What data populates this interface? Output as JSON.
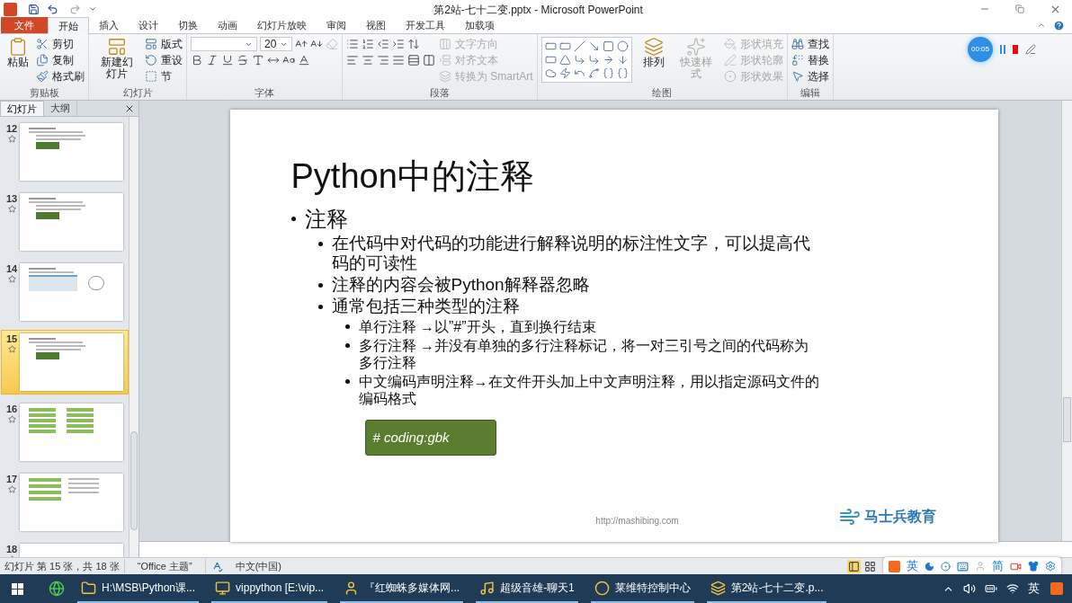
{
  "window": {
    "title": "第2站-七十二变.pptx - Microsoft PowerPoint"
  },
  "ribbon_tabs": [
    {
      "label": "文件",
      "kind": "file",
      "selected": false
    },
    {
      "label": "开始",
      "kind": "tab",
      "selected": true
    },
    {
      "label": "插入",
      "kind": "tab",
      "selected": false
    },
    {
      "label": "设计",
      "kind": "tab",
      "selected": false
    },
    {
      "label": "切换",
      "kind": "tab",
      "selected": false
    },
    {
      "label": "动画",
      "kind": "tab",
      "selected": false
    },
    {
      "label": "幻灯片放映",
      "kind": "tab",
      "selected": false
    },
    {
      "label": "审阅",
      "kind": "tab",
      "selected": false
    },
    {
      "label": "视图",
      "kind": "tab",
      "selected": false
    },
    {
      "label": "开发工具",
      "kind": "tab",
      "selected": false
    },
    {
      "label": "加载项",
      "kind": "tab",
      "selected": false
    }
  ],
  "ribbon_groups": [
    {
      "title": "剪贴板",
      "parts": [
        {
          "kind": "large",
          "label": "粘贴",
          "disabled": false
        },
        {
          "kind": "stack",
          "rows": [
            [
              {
                "kind": "small",
                "label": "剪切",
                "disabled": false
              }
            ],
            [
              {
                "kind": "small",
                "label": "复制",
                "disabled": false
              }
            ],
            [
              {
                "kind": "small",
                "label": "格式刷",
                "disabled": false
              }
            ]
          ]
        }
      ]
    },
    {
      "title": "幻灯片",
      "parts": [
        {
          "kind": "large",
          "label": "新建幻灯片",
          "disabled": false
        },
        {
          "kind": "stack",
          "rows": [
            [
              {
                "kind": "small",
                "label": "版式",
                "disabled": false
              }
            ],
            [
              {
                "kind": "small",
                "label": "重设",
                "disabled": false
              }
            ],
            [
              {
                "kind": "small",
                "label": "节",
                "disabled": false
              }
            ]
          ]
        }
      ]
    },
    {
      "title": "字体",
      "parts": [
        {
          "kind": "stack",
          "rows": [
            [
              {
                "kind": "select",
                "disabled": false,
                "wide": true
              },
              {
                "kind": "select",
                "value": "20",
                "disabled": false,
                "wide": false
              },
              {
                "kind": "icon",
                "disabled": false
              },
              {
                "kind": "icon",
                "disabled": false
              },
              {
                "kind": "icon",
                "disabled": true
              }
            ],
            [
              {
                "kind": "icon",
                "disabled": false
              },
              {
                "kind": "icon",
                "disabled": false
              },
              {
                "kind": "icon",
                "disabled": false
              },
              {
                "kind": "icon",
                "disabled": false
              },
              {
                "kind": "icon",
                "disabled": false
              },
              {
                "kind": "icon",
                "disabled": false
              },
              {
                "kind": "icon",
                "disabled": false
              },
              {
                "kind": "icon",
                "disabled": false
              }
            ]
          ]
        }
      ]
    },
    {
      "title": "段落",
      "parts": [
        {
          "kind": "stack",
          "rows": [
            [
              {
                "kind": "icon",
                "disabled": false
              },
              {
                "kind": "icon",
                "disabled": false
              },
              {
                "kind": "icon",
                "disabled": false
              },
              {
                "kind": "icon",
                "disabled": false
              },
              {
                "kind": "icon",
                "disabled": false
              }
            ],
            [
              {
                "kind": "icon",
                "disabled": false
              },
              {
                "kind": "icon",
                "disabled": false
              },
              {
                "kind": "icon",
                "disabled": false
              },
              {
                "kind": "icon",
                "disabled": false
              },
              {
                "kind": "icon",
                "disabled": false
              },
              {
                "kind": "icon",
                "disabled": false
              }
            ]
          ]
        },
        {
          "kind": "stack",
          "rows": [
            [
              {
                "kind": "small",
                "label": "文字方向",
                "disabled": true
              }
            ],
            [
              {
                "kind": "small",
                "label": "对齐文本",
                "disabled": true
              }
            ],
            [
              {
                "kind": "small",
                "label": "转换为 SmartArt",
                "disabled": true
              }
            ]
          ]
        }
      ]
    },
    {
      "title": "绘图",
      "parts": [
        {
          "kind": "gallery"
        },
        {
          "kind": "large",
          "label": "排列",
          "disabled": false
        },
        {
          "kind": "large",
          "label": "快速样式",
          "disabled": true
        },
        {
          "kind": "stack",
          "rows": [
            [
              {
                "kind": "small",
                "label": "形状填充",
                "disabled": true
              }
            ],
            [
              {
                "kind": "small",
                "label": "形状轮廓",
                "disabled": true
              }
            ],
            [
              {
                "kind": "small",
                "label": "形状效果",
                "disabled": true
              }
            ]
          ]
        }
      ]
    },
    {
      "title": "编辑",
      "parts": [
        {
          "kind": "stack",
          "rows": [
            [
              {
                "kind": "small",
                "label": "查找",
                "disabled": false
              }
            ],
            [
              {
                "kind": "small",
                "label": "替换",
                "disabled": false
              }
            ],
            [
              {
                "kind": "small",
                "label": "选择",
                "disabled": false
              }
            ]
          ]
        }
      ]
    }
  ],
  "recorder": {
    "time": "00:05"
  },
  "slides_panel": {
    "tabs": [
      {
        "label": "幻灯片",
        "selected": true
      },
      {
        "label": "大纲",
        "selected": false
      }
    ],
    "thumbnails": [
      {
        "number": "12",
        "selected": false,
        "kind": "list"
      },
      {
        "number": "13",
        "selected": false,
        "kind": "list"
      },
      {
        "number": "14",
        "selected": false,
        "kind": "table"
      },
      {
        "number": "15",
        "selected": true,
        "kind": "list"
      },
      {
        "number": "16",
        "selected": false,
        "kind": "map"
      },
      {
        "number": "17",
        "selected": false,
        "kind": "summary"
      },
      {
        "number": "18",
        "selected": false,
        "kind": "text"
      }
    ]
  },
  "slide": {
    "title": "Python中的注释",
    "bullets": [
      {
        "text": "注释",
        "children": [
          {
            "text": "在代码中对代码的功能进行解释说明的标注性文字，可以提高代码的可读性"
          },
          {
            "text": "注释的内容会被Python解释器忽略"
          },
          {
            "text": "通常包括三种类型的注释",
            "children": [
              {
                "text": "单行注释 →以”#”开头，直到换行结束"
              },
              {
                "text": "多行注释 →并没有单独的多行注释标记，将一对三引号之间的代码称为多行注释"
              },
              {
                "text": "中文编码声明注释→在文件开头加上中文声明注释，用以指定源码文件的编码格式"
              }
            ]
          }
        ]
      }
    ],
    "code_box": "# coding:gbk",
    "logo": "马士兵教育",
    "footer": "http://mashibing.com"
  },
  "status_bar": {
    "slide_info": "幻灯片 第 15 张，共 18 张",
    "theme": "“Office 主题”",
    "language": "中文(中国)"
  },
  "ime_bar": {
    "mode": "英",
    "script": "简"
  },
  "taskbar": {
    "items": [
      {
        "label": "H:\\MSB\\Python课..."
      },
      {
        "label": "vippython [E:\\vip..."
      },
      {
        "label": "『红蜘蛛多媒体网..."
      },
      {
        "label": "超级音雄-聊天1"
      },
      {
        "label": "莱维特控制中心"
      },
      {
        "label": "第2站-七十二变.p..."
      }
    ],
    "input_mode": "英"
  }
}
